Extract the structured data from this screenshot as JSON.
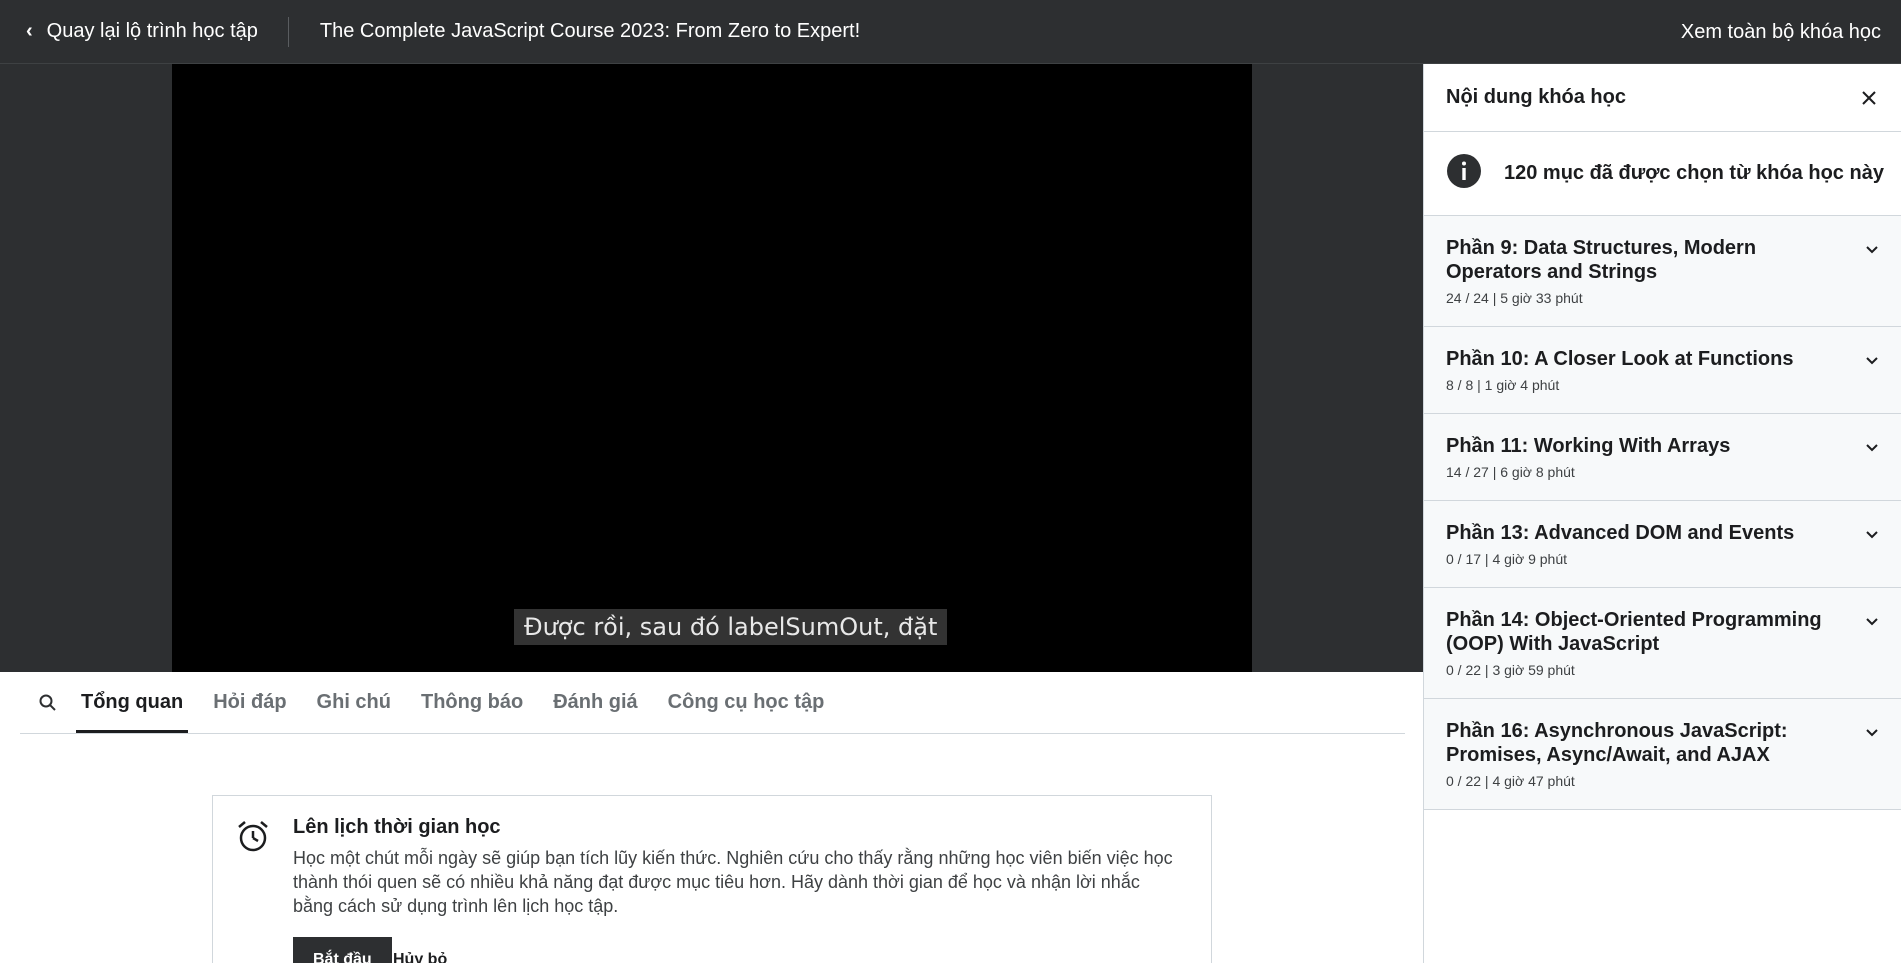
{
  "topbar": {
    "back_label": "Quay lại lộ trình học tập",
    "course_title": "The Complete JavaScript Course 2023: From Zero to Expert!",
    "view_all_label": "Xem toàn bộ khóa học"
  },
  "video": {
    "caption": "Được rồi, sau đó labelSumOut, đặt"
  },
  "tabs": [
    {
      "label": "Tổng quan",
      "active": true
    },
    {
      "label": "Hỏi đáp"
    },
    {
      "label": "Ghi chú"
    },
    {
      "label": "Thông báo"
    },
    {
      "label": "Đánh giá"
    },
    {
      "label": "Công cụ học tập"
    }
  ],
  "schedule": {
    "title": "Lên lịch thời gian học",
    "body": "Học một chút mỗi ngày sẽ giúp bạn tích lũy kiến thức. Nghiên cứu cho thấy rằng những học viên biến việc học thành thói quen sẽ có nhiều khả năng đạt được mục tiêu hơn. Hãy dành thời gian để học và nhận lời nhắc bằng cách sử dụng trình lên lịch học tập.",
    "start_label": "Bắt đầu",
    "cancel_label": "Hủy bỏ"
  },
  "sidebar": {
    "title": "Nội dung khóa học",
    "info": "120 mục đã được chọn từ khóa học này",
    "sections": [
      {
        "title": "Phần 9: Data Structures, Modern Operators and Strings",
        "meta": "24 / 24 | 5 giờ 33 phút"
      },
      {
        "title": "Phần 10: A Closer Look at Functions",
        "meta": "8 / 8 | 1 giờ 4 phút"
      },
      {
        "title": "Phần 11: Working With Arrays",
        "meta": "14 / 27 | 6 giờ 8 phút"
      },
      {
        "title": "Phần 13: Advanced DOM and Events",
        "meta": "0 / 17 | 4 giờ 9 phút"
      },
      {
        "title": "Phần 14: Object-Oriented Programming (OOP) With JavaScript",
        "meta": "0 / 22 | 3 giờ 59 phút"
      },
      {
        "title": "Phần 16: Asynchronous JavaScript: Promises, Async/Await, and AJAX",
        "meta": "0 / 22 | 4 giờ 47 phút"
      }
    ]
  }
}
